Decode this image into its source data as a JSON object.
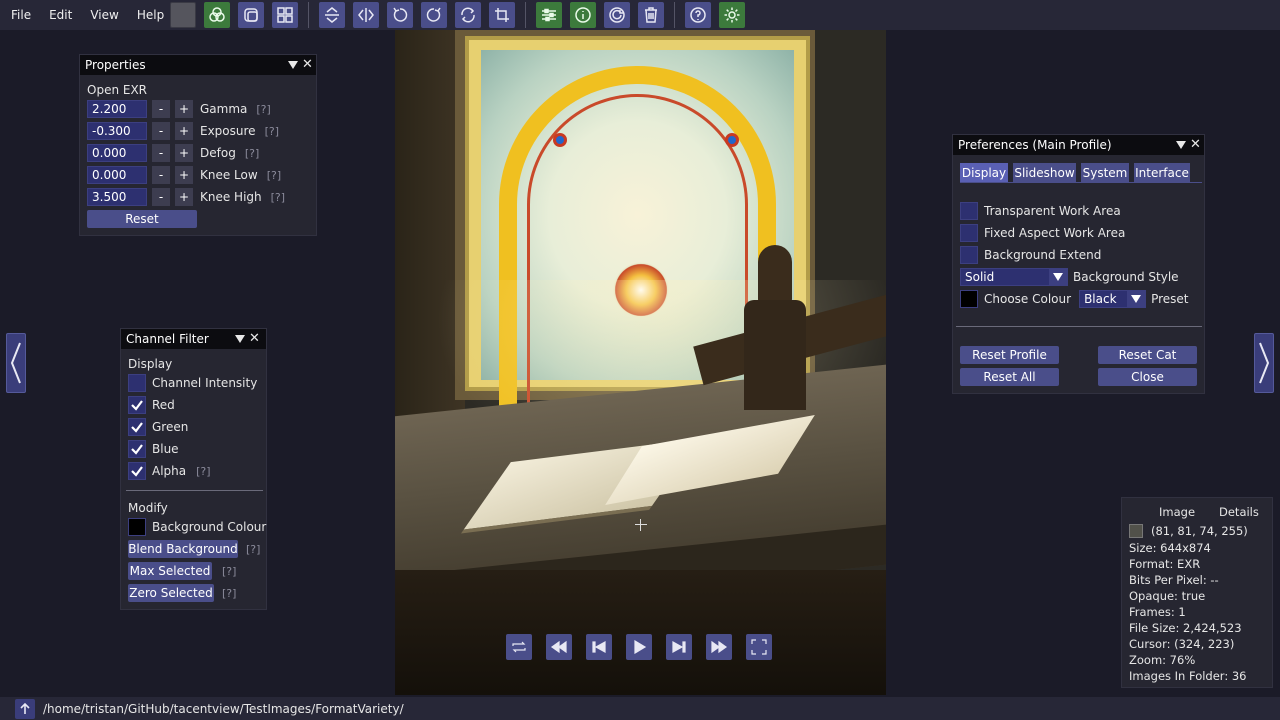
{
  "menu": [
    "File",
    "Edit",
    "View",
    "Help"
  ],
  "colors": {
    "accent": "#4a4e8a",
    "panel": "#262631",
    "title": "#0c0c10",
    "field": "#2d3070",
    "green_button": "#3c7a3c",
    "background": "#1b1b28"
  },
  "toolbar_icons": [
    "color-swatch-icon",
    "channels-icon",
    "tile-icon",
    "contact-sheet-icon",
    "flip-vertical-icon",
    "flip-horizontal-icon",
    "rotate-left-icon",
    "rotate-right-icon",
    "rotate-arbitrary-icon",
    "crop-icon",
    "adjust-icon",
    "info-icon",
    "refresh-icon",
    "delete-icon",
    "help-icon",
    "settings-icon"
  ],
  "properties": {
    "title": "Properties",
    "section": "Open EXR",
    "fields": [
      {
        "value": "2.200",
        "label": "Gamma",
        "help": "[?]"
      },
      {
        "value": "-0.300",
        "label": "Exposure",
        "help": "[?]"
      },
      {
        "value": "0.000",
        "label": "Defog",
        "help": "[?]"
      },
      {
        "value": "0.000",
        "label": "Knee Low",
        "help": "[?]"
      },
      {
        "value": "3.500",
        "label": "Knee High",
        "help": "[?]"
      }
    ],
    "minus": "-",
    "plus": "+",
    "reset": "Reset"
  },
  "channel_filter": {
    "title": "Channel Filter",
    "display_heading": "Display",
    "items": [
      {
        "label": "Channel Intensity",
        "checked": false
      },
      {
        "label": "Red",
        "checked": true
      },
      {
        "label": "Green",
        "checked": true
      },
      {
        "label": "Blue",
        "checked": true
      },
      {
        "label": "Alpha",
        "checked": true,
        "help": "[?]"
      }
    ],
    "modify_heading": "Modify",
    "background_colour": "Background Colour",
    "buttons": [
      {
        "label": "Blend Background",
        "help": "[?]"
      },
      {
        "label": "Max Selected",
        "help": "[?]"
      },
      {
        "label": "Zero Selected",
        "help": "[?]"
      }
    ]
  },
  "preferences": {
    "title": "Preferences (Main Profile)",
    "tabs": [
      "Display",
      "Slideshow",
      "System",
      "Interface"
    ],
    "active_tab": "Display",
    "checks": [
      "Transparent Work Area",
      "Fixed Aspect Work Area",
      "Background Extend"
    ],
    "bg_style_value": "Solid",
    "bg_style_label": "Background Style",
    "choose_colour": "Choose Colour",
    "preset_value": "Black",
    "preset_label": "Preset",
    "buttons": [
      "Reset Profile",
      "Reset Cat",
      "Reset All",
      "Close"
    ]
  },
  "details": {
    "tabs": [
      "Image",
      "Details"
    ],
    "pixel": "(81, 81, 74, 255)",
    "pixel_color": "#51514a",
    "lines": [
      "Size: 644x874",
      "Format: EXR",
      "Bits Per Pixel: --",
      "Opaque: true",
      "Frames: 1",
      "File Size: 2,424,523",
      "Cursor: (324, 223)",
      "Zoom: 76%",
      "Images In Folder: 36"
    ]
  },
  "playback_icons": [
    "loop-icon",
    "skip-first-icon",
    "prev-icon",
    "play-icon",
    "next-icon",
    "skip-last-icon",
    "fullscreen-icon"
  ],
  "status": {
    "path": "/home/tristan/GitHub/tacentview/TestImages/FormatVariety/"
  }
}
